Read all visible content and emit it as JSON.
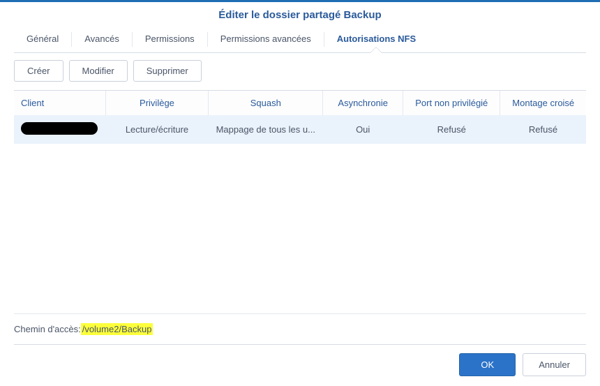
{
  "title": "Éditer le dossier partagé Backup",
  "tabs": {
    "general": "Général",
    "advanced": "Avancés",
    "permissions": "Permissions",
    "adv_permissions": "Permissions avancées",
    "nfs": "Autorisations NFS"
  },
  "toolbar": {
    "create": "Créer",
    "modify": "Modifier",
    "delete": "Supprimer"
  },
  "table": {
    "headers": {
      "client": "Client",
      "privilege": "Privilège",
      "squash": "Squash",
      "async": "Asynchronie",
      "port": "Port non privilégié",
      "mount": "Montage croisé"
    },
    "rows": [
      {
        "client": "",
        "privilege": "Lecture/écriture",
        "squash": "Mappage de tous les u...",
        "async": "Oui",
        "port": "Refusé",
        "mount": "Refusé"
      }
    ]
  },
  "footer": {
    "path_label": "Chemin d'accès:",
    "path_value": "/volume2/Backup",
    "ok": "OK",
    "cancel": "Annuler"
  }
}
